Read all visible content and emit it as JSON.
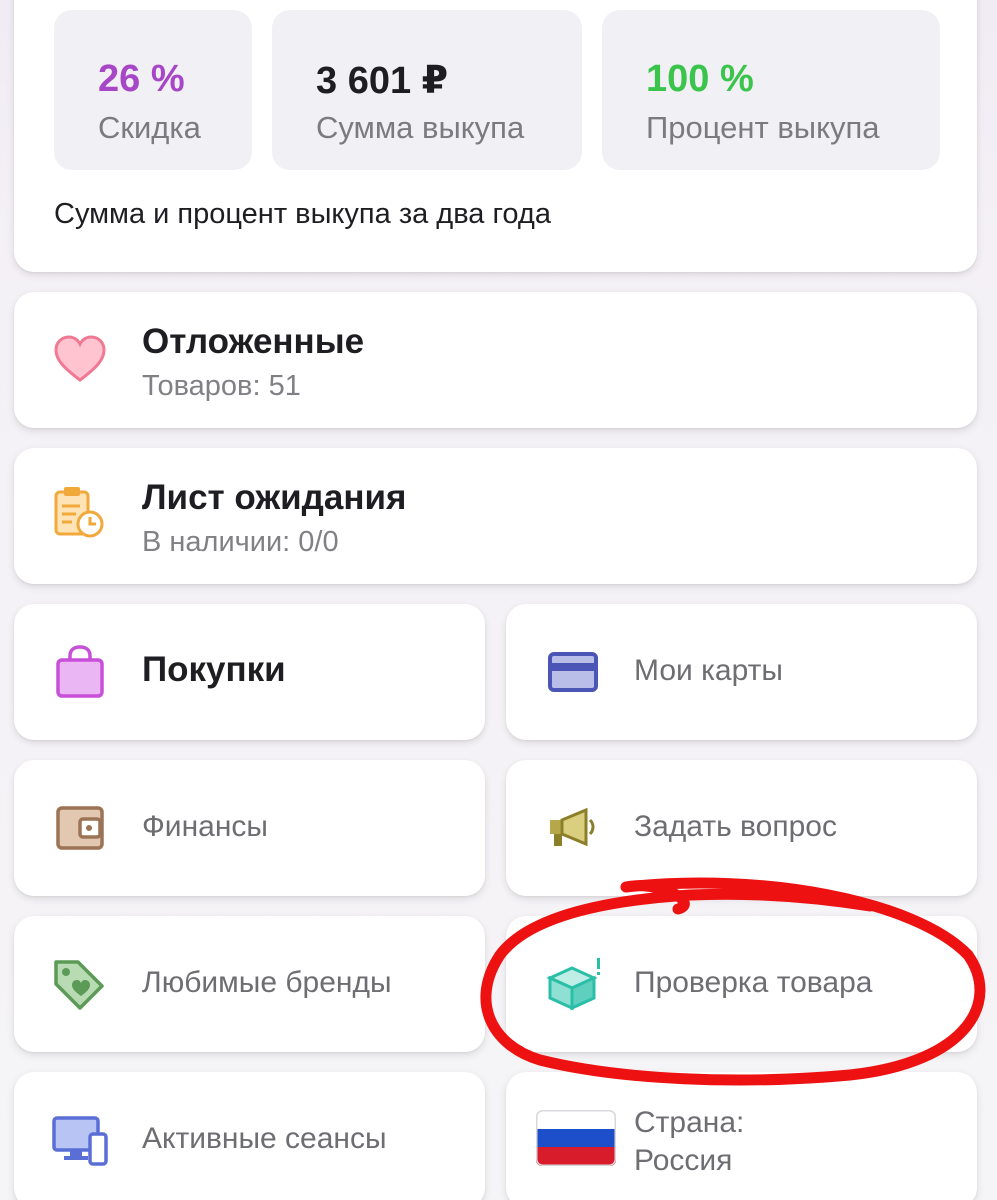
{
  "stats": {
    "items": [
      {
        "value": "26 %",
        "label": "Скидка",
        "color": "#a746c6"
      },
      {
        "value": "3 601 ₽",
        "label": "Сумма выкупа",
        "color": "#1e1e22"
      },
      {
        "value": "100 %",
        "label": "Процент выкупа",
        "color": "#3bc44b"
      }
    ],
    "note": "Сумма и процент выкупа за два года"
  },
  "rows": [
    {
      "title": "Отложенные",
      "subtitle": "Товаров: 51",
      "icon": "heart-icon"
    },
    {
      "title": "Лист ожидания",
      "subtitle": "В наличии: 0/0",
      "icon": "clipboard-clock-icon"
    }
  ],
  "tiles": [
    {
      "label": "Покупки",
      "icon": "shopping-bag-icon",
      "emphasis": true
    },
    {
      "label": "Мои карты",
      "icon": "credit-card-icon"
    },
    {
      "label": "Финансы",
      "icon": "wallet-icon"
    },
    {
      "label": "Задать вопрос",
      "icon": "megaphone-icon"
    },
    {
      "label": "Любимые бренды",
      "icon": "tag-heart-icon"
    },
    {
      "label": "Проверка товара",
      "icon": "box-check-icon"
    },
    {
      "label": "Активные сеансы",
      "icon": "devices-icon"
    },
    {
      "label": "Страна: Россия",
      "label_line1": "Страна:",
      "label_line2": "Россия",
      "icon": "russia-flag-icon"
    }
  ],
  "annotation": {
    "color": "#ee1111",
    "target": "Проверка товара"
  }
}
